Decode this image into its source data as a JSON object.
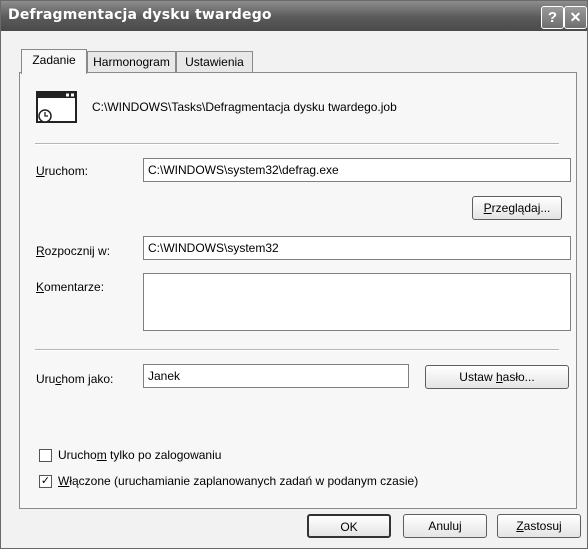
{
  "window": {
    "title": "Defragmentacja dysku twardego"
  },
  "tabs": [
    {
      "label": "Zadanie"
    },
    {
      "label": "Harmonogram"
    },
    {
      "label": "Ustawienia"
    }
  ],
  "task": {
    "path": "C:\\WINDOWS\\Tasks\\Defragmentacja dysku twardego.job"
  },
  "run": {
    "label_pre": "",
    "label_key": "U",
    "label_post": "ruchom:",
    "value": "C:\\WINDOWS\\system32\\defrag.exe"
  },
  "browse": {
    "label_pre": "",
    "label_key": "P",
    "label_post": "rzeglądaj..."
  },
  "start_in": {
    "label_pre": "",
    "label_key": "R",
    "label_post": "ozpocznij w:",
    "value": "C:\\WINDOWS\\system32"
  },
  "comments": {
    "label_pre": "",
    "label_key": "K",
    "label_post": "omentarze:",
    "value": ""
  },
  "run_as": {
    "label_pre": "Uru",
    "label_key": "c",
    "label_post": "hom jako:",
    "value": "Janek"
  },
  "set_password": {
    "label_pre": "Ustaw ",
    "label_key": "h",
    "label_post": "asło..."
  },
  "logged_on": {
    "label_pre": "Urucho",
    "label_key": "m",
    "label_post": " tylko po zalogowaniu",
    "checked": false
  },
  "enabled": {
    "label_pre": "",
    "label_key": "W",
    "label_post": "łączone (uruchamianie zaplanowanych zadań w podanym czasie)",
    "checked": true,
    "checkmark": "✓"
  },
  "footer": {
    "ok": "OK",
    "cancel": "Anuluj",
    "apply_pre": "",
    "apply_key": "Z",
    "apply_post": "astosuj"
  },
  "icons": {
    "help": "?",
    "close": "✕"
  }
}
